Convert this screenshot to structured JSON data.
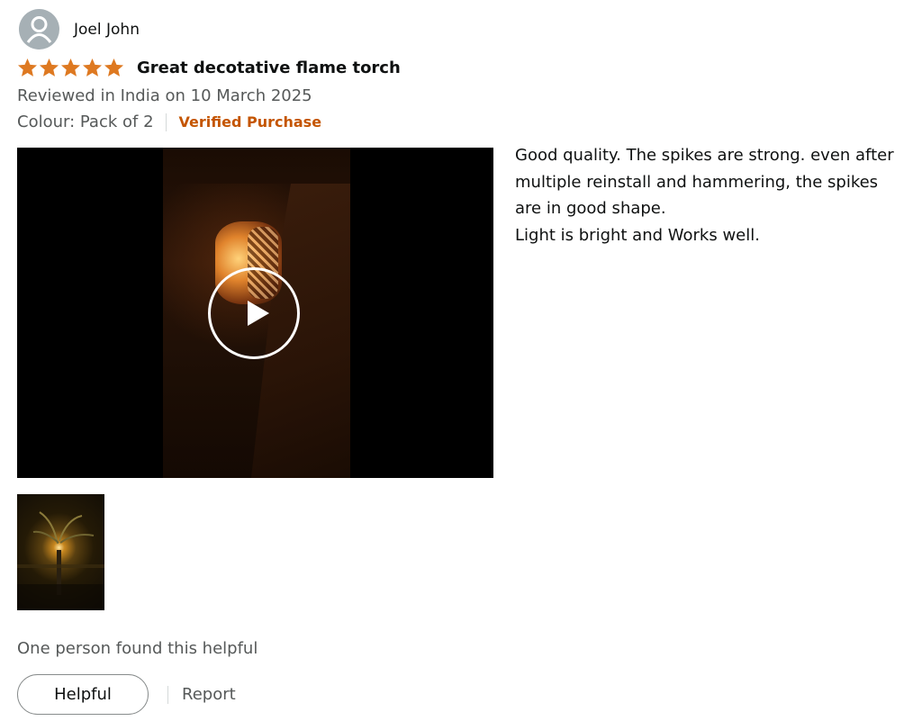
{
  "reviewer": {
    "name": "Joel John",
    "avatar_icon": "user-avatar-icon"
  },
  "rating": {
    "stars": 5,
    "max": 5,
    "color": "#de7921"
  },
  "review": {
    "title": "Great decotative flame torch",
    "date_text": "Reviewed in India on 10 March 2025",
    "variant": "Colour: Pack of 2",
    "verified_label": "Verified Purchase",
    "body_lines": [
      "Good quality. The spikes are strong. even after",
      "multiple reinstall and hammering, the spikes",
      "are in good shape.",
      "Light is bright and Works well."
    ]
  },
  "media": {
    "video_icon": "play-icon",
    "thumbnail_icon": "image-thumbnail"
  },
  "footer": {
    "helpful_count_text": "One person found this helpful",
    "helpful_button_label": "Helpful",
    "report_label": "Report"
  },
  "colors": {
    "verified": "#c45500",
    "secondary_text": "#565959",
    "star": "#de7921"
  }
}
